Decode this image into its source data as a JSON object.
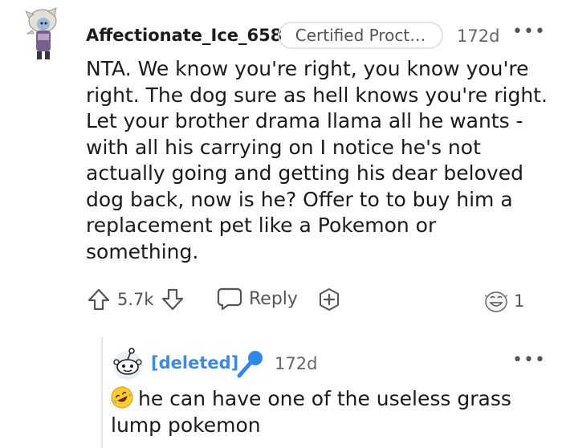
{
  "comment": {
    "username": "Affectionate_Ice_658",
    "flair": "Certified Proct…",
    "age": "172d",
    "more_icon": "more-horizontal-icon",
    "body": "NTA. We know you're right, you know you're right. The dog sure as hell knows you're right. Let your brother drama llama all he wants - with all his carrying on I notice he's not actually going and getting his dear beloved dog back, now is he? Offer to to buy him a replacement pet like a Pokemon or something.",
    "score": "5.7k",
    "reply_label": "Reply",
    "award_count": "1"
  },
  "reply": {
    "username": "[deleted]",
    "age": "172d",
    "body": "he can have one of the useless grass lump pokemon",
    "emoji_icon": "rolling-laughing-emoji-icon",
    "mic_color": "#2e8ae6"
  },
  "colors": {
    "username_link": "#3d8bd9",
    "muted": "#555555"
  }
}
